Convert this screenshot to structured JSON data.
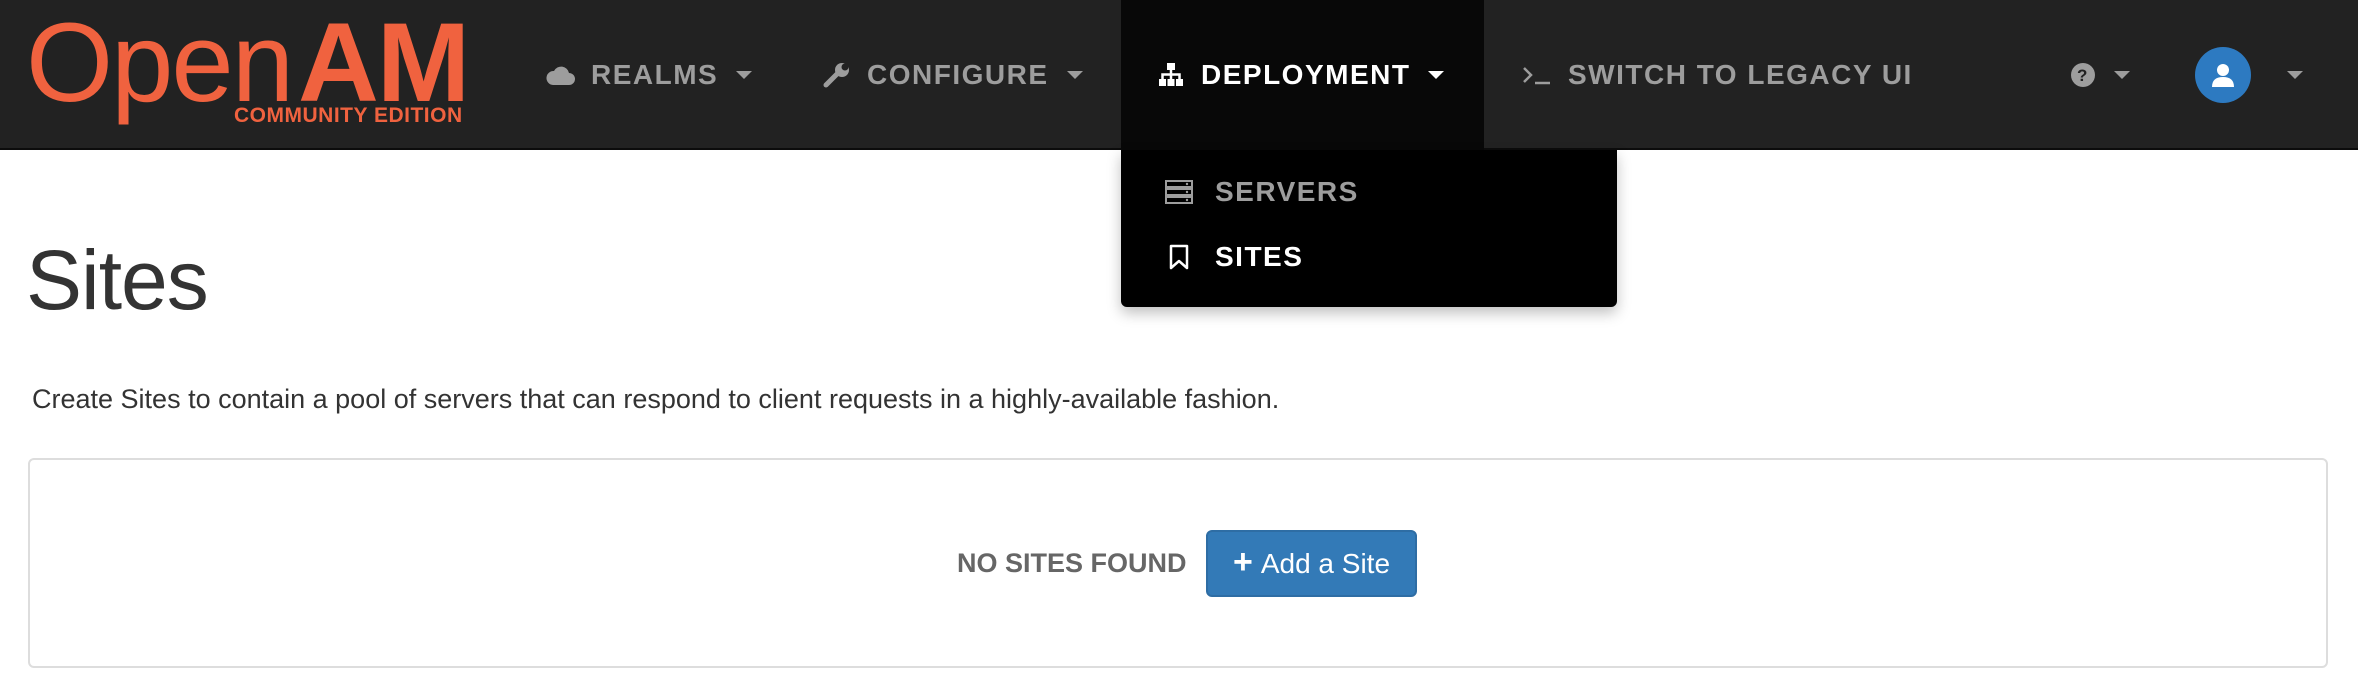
{
  "brand": {
    "name_part1": "Open",
    "name_part2": "AM",
    "edition": "COMMUNITY EDITION",
    "color": "#f0623f"
  },
  "nav": {
    "realms": {
      "label": "REALMS",
      "icon": "cloud-icon"
    },
    "configure": {
      "label": "CONFIGURE",
      "icon": "wrench-icon"
    },
    "deployment": {
      "label": "DEPLOYMENT",
      "icon": "sitemap-icon",
      "active": true
    },
    "legacy": {
      "label": "SWITCH TO LEGACY UI",
      "icon": "terminal-icon"
    },
    "help": {
      "icon": "question-circle-icon"
    },
    "user": {
      "icon": "user-icon"
    }
  },
  "dropdown": {
    "items": [
      {
        "label": "SERVERS",
        "icon": "server-icon"
      },
      {
        "label": "SITES",
        "icon": "bookmark-icon"
      }
    ]
  },
  "page": {
    "title": "Sites",
    "description": "Create Sites to contain a pool of servers that can respond to client requests in a highly-available fashion."
  },
  "empty_state": {
    "message": "NO SITES FOUND",
    "add_button_label": "Add a Site"
  },
  "colors": {
    "navbar_bg": "#222222",
    "nav_text": "#9d9d9d",
    "active_bg": "#080808",
    "primary_button": "#337ab7",
    "avatar_bg": "#2d7ac1"
  }
}
